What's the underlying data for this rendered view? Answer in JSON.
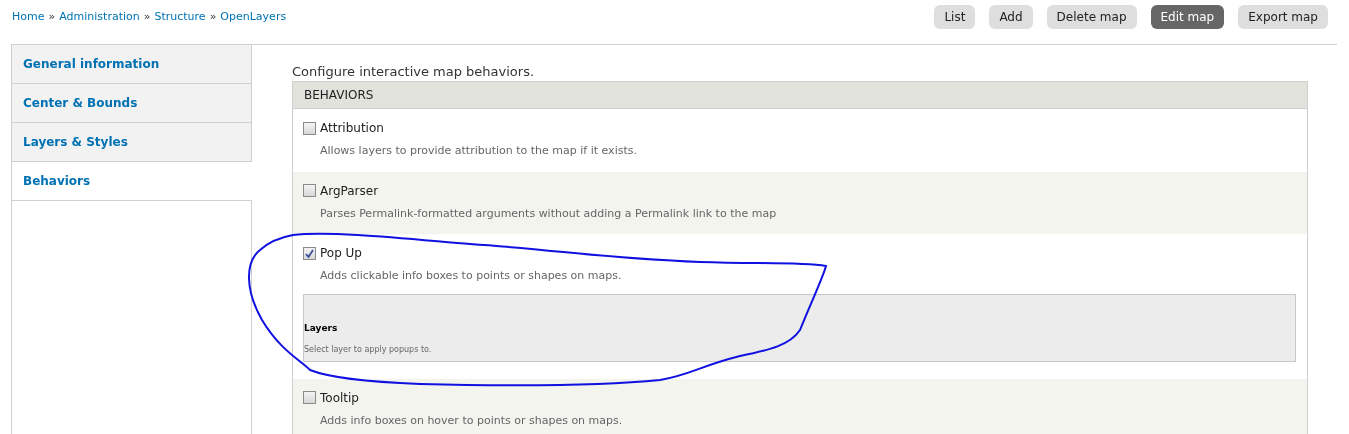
{
  "breadcrumb": [
    "Home",
    "Administration",
    "Structure",
    "OpenLayers"
  ],
  "breadcrumb_separator": "»",
  "actions": [
    {
      "label": "List",
      "selected": false
    },
    {
      "label": "Add",
      "selected": false
    },
    {
      "label": "Delete map",
      "selected": false
    },
    {
      "label": "Edit map",
      "selected": true
    },
    {
      "label": "Export map",
      "selected": false
    }
  ],
  "tabs": [
    {
      "label": "General information",
      "selected": false
    },
    {
      "label": "Center & Bounds",
      "selected": false
    },
    {
      "label": "Layers & Styles",
      "selected": false
    },
    {
      "label": "Behaviors",
      "selected": true
    }
  ],
  "intro": "Configure interactive map behaviors.",
  "table": {
    "header": "BEHAVIORS",
    "rows": [
      {
        "label": "Attribution",
        "checked": false,
        "description": "Allows layers to provide attribution to the map if it exists."
      },
      {
        "label": "ArgParser",
        "checked": false,
        "description": "Parses Permalink-formatted arguments without adding a Permalink link to the map"
      },
      {
        "label": "Pop Up",
        "checked": true,
        "description": "Adds clickable info boxes to points or shapes on maps.",
        "settings": {
          "title": "Layers",
          "description": "Select layer to apply popups to."
        }
      },
      {
        "label": "Tooltip",
        "checked": false,
        "description": "Adds info boxes on hover to points or shapes on maps."
      }
    ]
  }
}
